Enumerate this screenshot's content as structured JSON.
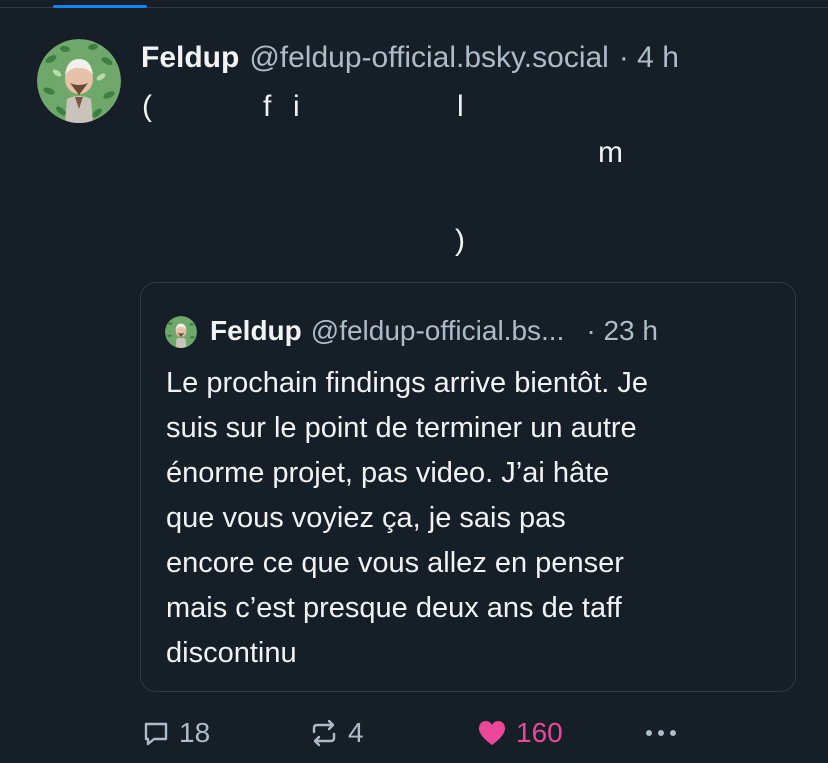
{
  "post": {
    "author": {
      "name": "Feldup",
      "handle": "@feldup-official.bsky.social",
      "time": "· 4 h"
    },
    "text_fragments": {
      "open_paren": "(",
      "f": "f",
      "i": "i",
      "l": "l",
      "m": "m",
      "close_paren": ")"
    },
    "quote": {
      "author": {
        "name": "Feldup",
        "handle": "@feldup-official.bs...",
        "time": "· 23 h"
      },
      "text": "Le prochain findings arrive bientôt. Je\nsuis sur le point de terminer un autre\nénorme projet, pas video. J’ai hâte\nque vous voyiez ça, je sais pas\nencore ce que vous allez en penser\nmais c’est presque deux ans de taff\ndiscontinu"
    },
    "actions": {
      "replies": "18",
      "reposts": "4",
      "likes": "160",
      "reply_icon": "reply-bubble-icon",
      "repost_icon": "repost-icon",
      "like_icon": "heart-icon",
      "more_icon": "more-dots-icon"
    }
  },
  "colors": {
    "background": "#161e27",
    "text": "#f1f3f5",
    "muted": "#aebbc9",
    "border": "#2e3a48",
    "accent": "#1083fe",
    "like": "#ec4899"
  }
}
